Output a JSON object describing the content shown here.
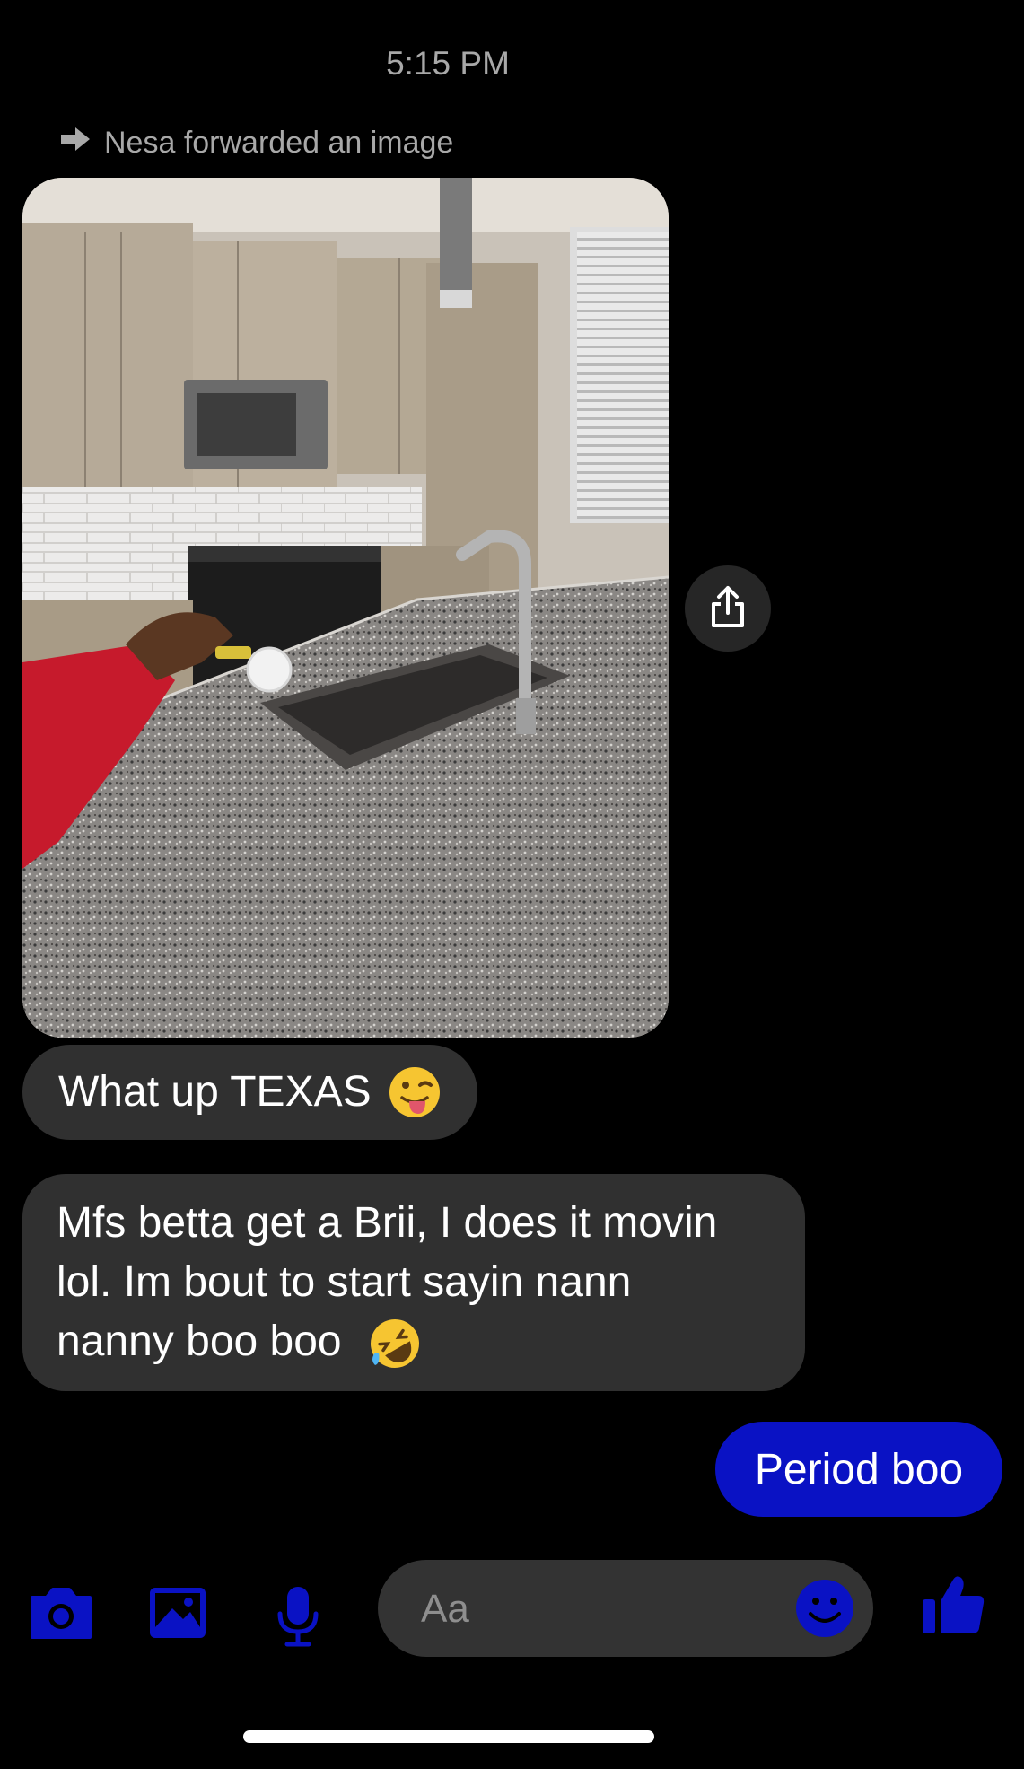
{
  "status": {
    "time": "5:15 PM"
  },
  "forward_note": {
    "text": "Nesa forwarded an image",
    "icon": "arrow-right-icon"
  },
  "messages": {
    "incoming_1": {
      "text": "What up TEXAS",
      "emoji": "tongue-out-face-emoji"
    },
    "incoming_2": {
      "lines": [
        "Mfs betta get a Brii, I does it movin",
        "lol. Im bout to start sayin nann",
        "nanny boo boo"
      ],
      "emoji": "rolling-on-floor-laughing-emoji"
    },
    "outgoing_1": {
      "text": "Period boo"
    }
  },
  "composer": {
    "placeholder": "Aa",
    "icons": [
      "camera-icon",
      "gallery-icon",
      "microphone-icon",
      "emoji-icon",
      "thumbs-up-icon"
    ]
  },
  "colors": {
    "accent": "#0a12c4",
    "bubble_in": "#303030",
    "background": "#000000"
  }
}
